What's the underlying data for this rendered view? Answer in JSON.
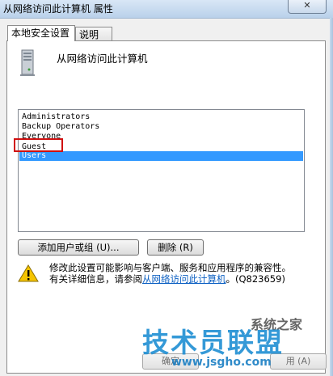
{
  "window": {
    "title": "从网络访问此计算机 属性",
    "close_label": "✕"
  },
  "tabs": [
    {
      "label": "本地安全设置",
      "active": true
    },
    {
      "label": "说明",
      "active": false
    }
  ],
  "policy": {
    "name": "从网络访问此计算机",
    "icon": "server-icon"
  },
  "accounts": {
    "items": [
      "Administrators",
      "Backup Operators",
      "Everyone",
      "Guest",
      "Users"
    ],
    "selected": "Users",
    "highlighted": "Guest"
  },
  "buttons": {
    "add_label": "添加用户或组 (U)...",
    "remove_label": "删除 (R)",
    "ok_label": "确定",
    "apply_label": "用 (A)"
  },
  "note": {
    "line1": "修改此设置可能影响与客户端、服务和应用程序的兼容性。",
    "line2_prefix": "有关详细信息，请参阅",
    "link_text": "从网络访问此计算机",
    "kb": "。(Q823659)",
    "icon": "warning-icon"
  },
  "watermark": {
    "brand": "技术员联盟",
    "site": "系统之家",
    "url": "www.jsgho.com"
  },
  "colors": {
    "selection": "#3399ff",
    "highlight_border": "#d01010",
    "link": "#0b5fc2"
  }
}
